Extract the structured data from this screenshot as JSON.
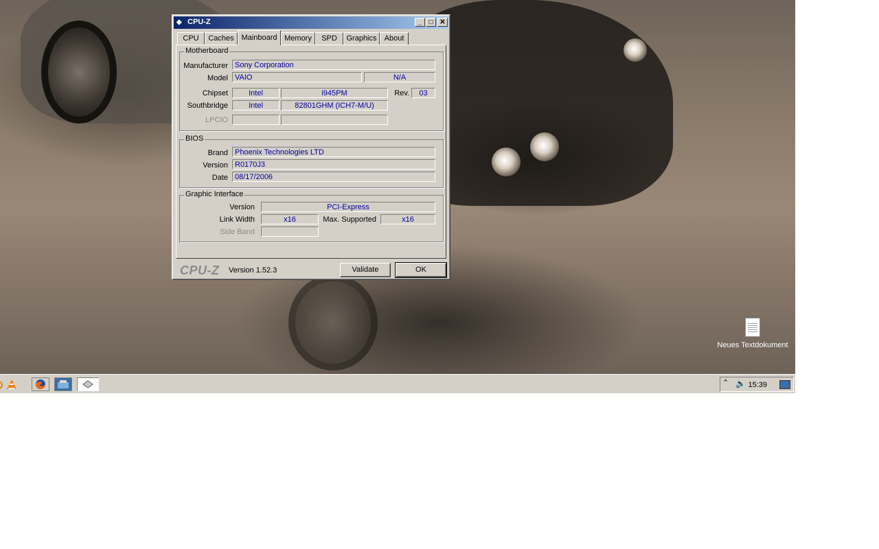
{
  "window": {
    "title": "CPU-Z",
    "minimize": "_",
    "maximize": "□",
    "close": "✕"
  },
  "tabs": [
    "CPU",
    "Caches",
    "Mainboard",
    "Memory",
    "SPD",
    "Graphics",
    "About"
  ],
  "active_tab": "Mainboard",
  "motherboard": {
    "title": "Motherboard",
    "manufacturer_label": "Manufacturer",
    "manufacturer": "Sony Corporation",
    "model_label": "Model",
    "model": "VAIO",
    "model_extra": "N/A",
    "chipset_label": "Chipset",
    "chipset_vendor": "Intel",
    "chipset_model": "i945PM",
    "rev_label": "Rev.",
    "rev": "03",
    "southbridge_label": "Southbridge",
    "southbridge_vendor": "Intel",
    "southbridge_model": "82801GHM (ICH7-M/U)",
    "lpcio_label": "LPCIO"
  },
  "bios": {
    "title": "BIOS",
    "brand_label": "Brand",
    "brand": "Phoenix Technologies LTD",
    "version_label": "Version",
    "version": "R0170J3",
    "date_label": "Date",
    "date": "08/17/2006"
  },
  "graphic_interface": {
    "title": "Graphic Interface",
    "version_label": "Version",
    "version": "PCI-Express",
    "link_width_label": "Link Width",
    "link_width": "x16",
    "max_supported_label": "Max. Supported",
    "max_supported": "x16",
    "side_band_label": "Side Band"
  },
  "footer": {
    "logo": "CPU-Z",
    "version": "Version 1.52.3",
    "validate": "Validate",
    "ok": "OK"
  },
  "desktop": {
    "icon_label": "Neues Textdokument"
  },
  "taskbar": {
    "quicklaunch_icons": [
      "vlc-icon",
      "firefox-icon",
      "desktop-icon",
      "cpuz-task-icon"
    ],
    "clock": "15:39"
  },
  "colors": {
    "titlebar_start": "#0a246a",
    "titlebar_end": "#a6caf0",
    "field_text": "#0000a0",
    "window_face": "#d4d0c8"
  }
}
